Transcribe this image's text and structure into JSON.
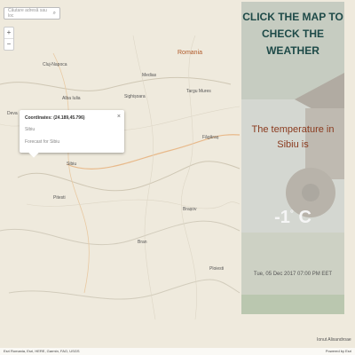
{
  "map": {
    "search_placeholder": "Căutare adresă sau loc",
    "zoom_in": "+",
    "zoom_out": "−",
    "country_label": "Romania",
    "places": [
      "Cluj-Napoca",
      "Alba Iulia",
      "Sibiu",
      "Brașov",
      "Sighișoara",
      "Medias",
      "Bran",
      "Deva",
      "Pitesti",
      "Targu Mures",
      "Făgăraș",
      "Ploiesti"
    ]
  },
  "popup": {
    "title": "Coordinates: (24.189,45.796)",
    "city": "Sibiu",
    "search_label": "Forecast for Sibiu",
    "close": "×"
  },
  "panel": {
    "headline": "CLICK THE MAP TO CHECK THE WEATHER",
    "temp_label": "The temperature in Sibiu is",
    "temp_value": "-1",
    "temp_unit": "C",
    "degree": "°",
    "datetime": "Tue, 05 Dec 2017 07:00 PM EET"
  },
  "footer": {
    "credit": "Ionut Alixandroae",
    "attribution": "Esri Romania, Esri, HERE, Garmin, FAO, USGS",
    "powered": "Powered by Esri"
  }
}
